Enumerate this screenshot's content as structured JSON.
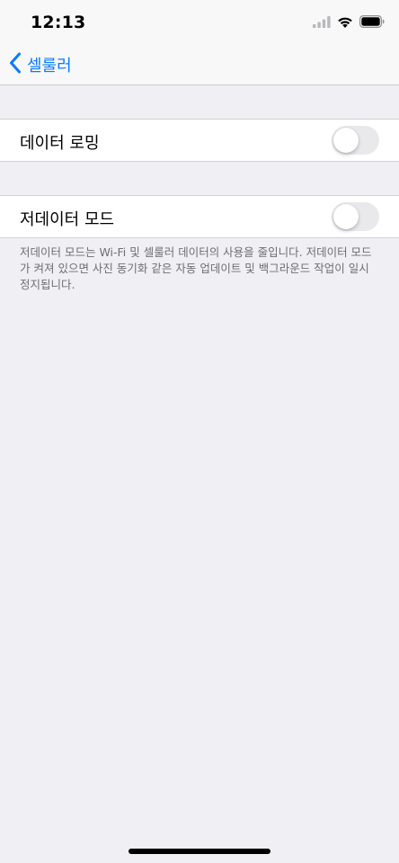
{
  "status_bar": {
    "time": "12:13"
  },
  "nav": {
    "back_label": "셀룰러"
  },
  "settings": {
    "data_roaming": {
      "label": "데이터 로밍",
      "enabled": false
    },
    "low_data_mode": {
      "label": "저데이터 모드",
      "enabled": false,
      "footer": "저데이터 모드는 Wi-Fi 및 셀룰러 데이터의 사용을 줄입니다. 저데이터 모드가 켜져 있으면 사진 동기화 같은 자동 업데이트 및 백그라운드 작업이 일시 정지됩니다."
    }
  },
  "icons": {
    "signal": "cellular-signal-icon",
    "wifi": "wifi-icon",
    "battery": "battery-icon",
    "back": "chevron-left-icon"
  },
  "colors": {
    "accent": "#0a7aff",
    "background": "#efeff4",
    "toggle_off": "#e9e9eb"
  }
}
